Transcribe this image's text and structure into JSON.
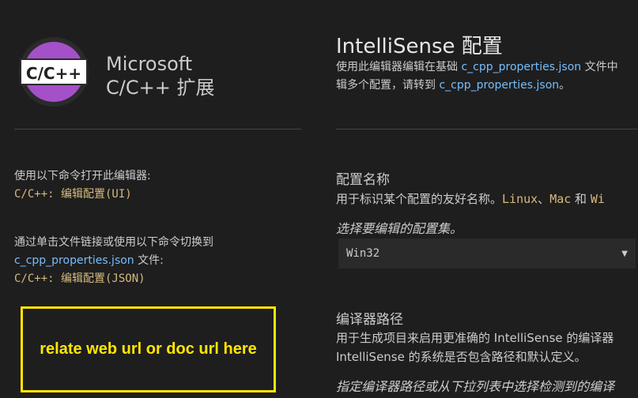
{
  "extension": {
    "logo_text": "C/C++",
    "name_line1": "Microsoft",
    "name_line2": "C/C++ 扩展"
  },
  "sidebar": {
    "block1_label": "使用以下命令打开此编辑器:",
    "block1_command": "C/C++: 编辑配置(UI)",
    "block2_label": "通过单击文件链接或使用以下命令切换到",
    "block2_link": "c_cpp_properties.json",
    "block2_suffix": " 文件:",
    "block2_command": "C/C++: 编辑配置(JSON)",
    "note": "relate web url or doc url here"
  },
  "main": {
    "title": "IntelliSense 配置",
    "desc_prefix": "使用此编辑器编辑在基础 ",
    "desc_link1": "c_cpp_properties.json",
    "desc_mid": " 文件中",
    "desc_line2_prefix": "辑多个配置，请转到 ",
    "desc_link2": "c_cpp_properties.json",
    "desc_line2_suffix": "。",
    "config_name": {
      "title": "配置名称",
      "desc": "用于标识某个配置的友好名称。",
      "code1": "Linux",
      "sep1": "、",
      "code2": "Mac",
      "sep2": " 和 ",
      "code3": "Wi",
      "hint": "选择要编辑的配置集。",
      "select_value": "Win32",
      "select_arrow": "▼"
    },
    "compiler_path": {
      "title": "编译器路径",
      "desc_line1": "用于生成项目来启用更准确的 IntelliSense 的编译器",
      "desc_line2": "IntelliSense 的系统是否包含路径和默认定义。",
      "hint": "指定编译器路径或从下拉列表中选择检测到的编译"
    }
  },
  "colors": {
    "background": "#1e1e1e",
    "link": "#75beff",
    "command": "#d7ba7d",
    "logo_purple": "#a450c8",
    "note_yellow": "#ffe600"
  }
}
